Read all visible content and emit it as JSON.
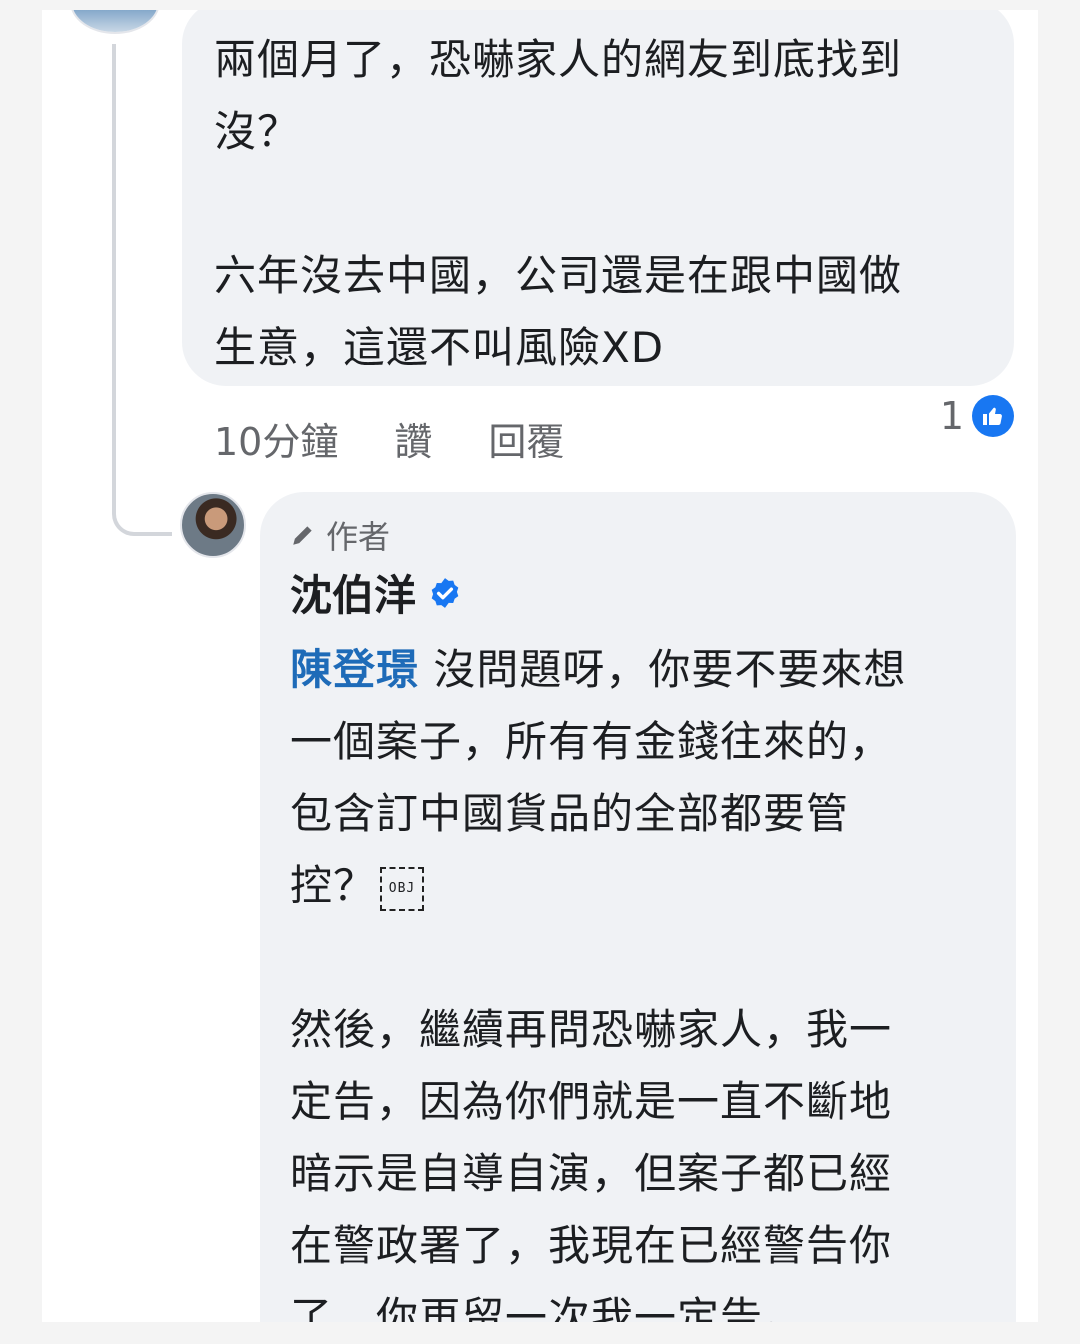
{
  "comment": {
    "text": "兩個月了，恐嚇家人的網友到底找到\n沒？\n\n六年沒去中國，公司還是在跟中國做\n生意，這還不叫風險XD",
    "time": "10分鐘",
    "like_label": "讚",
    "reply_label": "回覆",
    "reaction_count": "1"
  },
  "reply": {
    "author_tag": "作者",
    "author_name": "沈伯洋",
    "mention": "陳登璟",
    "paragraph1": "沒問題呀，你要不要來想\n一個案子，所有有金錢往來的，\n包含訂中國貨品的全部都要管\n控？",
    "obj_placeholder": "OBJ",
    "paragraph2": "然後，繼續再問恐嚇家人，我一\n定告，因為你們就是一直不斷地\n暗示是自導自演，但案子都已經\n在警政署了，我現在已經警告你\n了，你再留一次我一定告。"
  },
  "colors": {
    "bubble": "#f0f2f5",
    "mention": "#1e6bb8",
    "like_blue": "#1877f2",
    "meta_gray": "#65676b"
  }
}
